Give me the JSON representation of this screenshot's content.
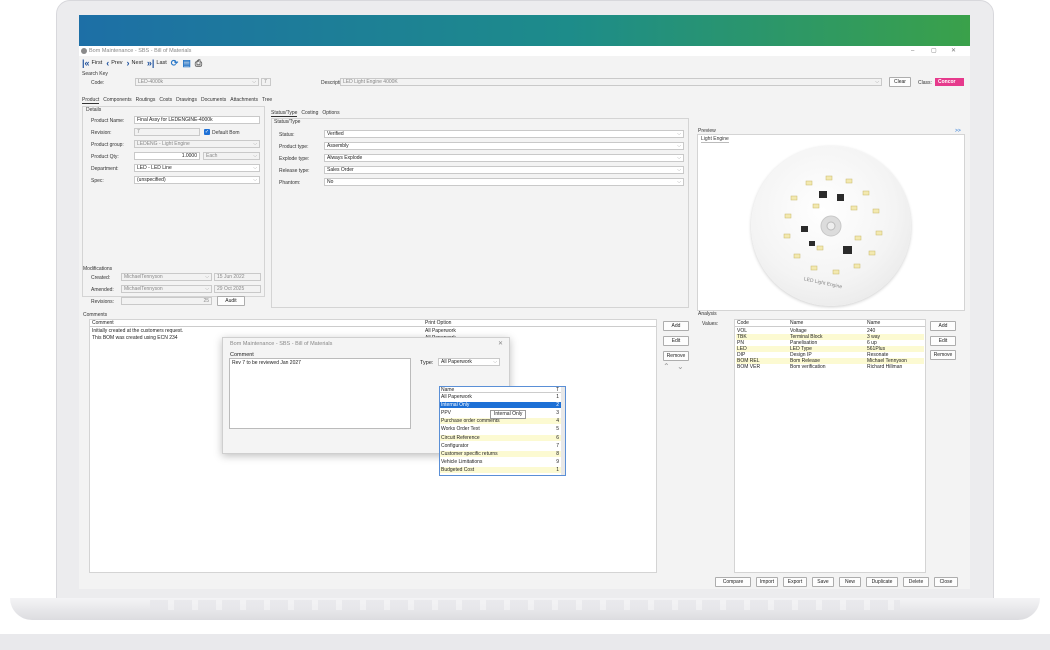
{
  "window": {
    "title": "Bom Maintenance - SBS - Bill of Materials"
  },
  "toolbar": {
    "first": "First",
    "prev": "Prev",
    "next": "Next",
    "last": "Last"
  },
  "search_key": {
    "title": "Search Key",
    "code_label": "Code:",
    "code_value": "LED-4000k",
    "revision_value": "7",
    "description_label": "Description:",
    "description_value": "LED Light Engine 4000K",
    "clear_label": "Clear",
    "class_label": "Class:",
    "class_value": "Concor"
  },
  "main_tabs": [
    "Product",
    "Components",
    "Routings",
    "Costs",
    "Drawings",
    "Documents",
    "Attachments",
    "Tree"
  ],
  "details": {
    "title": "Details",
    "product_name_label": "Product Name:",
    "product_name_value": "Final Assy for LEDENGINE-4000k",
    "revision_label": "Revision:",
    "revision_value": "7",
    "default_bom_label": "Default Bom",
    "product_group_label": "Product group:",
    "product_group_value": "LEDENG - Light Engine",
    "product_qty_label": "Product Qty:",
    "product_qty_value": "1.0000",
    "product_qty_unit": "Each",
    "department_label": "Department:",
    "department_value": "LED - LED Line",
    "spec_label": "Spec:",
    "spec_value": "(unspecified)"
  },
  "status_tabs": [
    "Status/Type",
    "Costing",
    "Options"
  ],
  "status_type": {
    "title": "Status/Type",
    "rows": [
      {
        "label": "Status:",
        "value": "Verified"
      },
      {
        "label": "Product type:",
        "value": "Assembly"
      },
      {
        "label": "Explode type:",
        "value": "Always Explode"
      },
      {
        "label": "Release type:",
        "value": "Sales Order"
      },
      {
        "label": "Phantom:",
        "value": "No"
      }
    ]
  },
  "preview": {
    "title": "Preview",
    "expand": ">>",
    "tab": "Light Engine"
  },
  "modifications": {
    "title": "Modifications",
    "created_label": "Created:",
    "created_user": "MichaelTennyson",
    "created_date": "15 Jun 2022",
    "amended_label": "Amended:",
    "amended_user": "MichaelTennyson",
    "amended_date": "29 Oct 2025",
    "revisions_label": "Revisions:",
    "revisions_value": "25",
    "audit_label": "Audit"
  },
  "comments": {
    "title": "Comments",
    "columns": [
      "Comment",
      "Print Option"
    ],
    "rows": [
      {
        "comment": "Initially created at the customers request.",
        "print": "All Paperwork"
      },
      {
        "comment": "This BOM was created using ECN 234",
        "print": "All Paperwork"
      }
    ],
    "add": "Add",
    "edit": "Edit",
    "remove": "Remove"
  },
  "analysis": {
    "title": "Analysis",
    "values_label": "Values:",
    "columns": [
      "Code",
      "Name",
      "Name"
    ],
    "rows": [
      {
        "code": "VOL",
        "name": "Voltage",
        "value": "240"
      },
      {
        "code": "TBK",
        "name": "Terminal Block",
        "value": "3 way"
      },
      {
        "code": "PN",
        "name": "Panelisation",
        "value": "6 up"
      },
      {
        "code": "LED",
        "name": "LED Type",
        "value": "561Plus"
      },
      {
        "code": "DIP",
        "name": "Design IP",
        "value": "Resonate"
      },
      {
        "code": "BOM REL",
        "name": "Bom Release",
        "value": "Michael Tennyson"
      },
      {
        "code": "BOM VER",
        "name": "Bom verification",
        "value": "Richard Hillman"
      }
    ],
    "add": "Add",
    "edit": "Edit",
    "remove": "Remove"
  },
  "dialog": {
    "title": "Bom Maintenance - SBS - Bill of Materials",
    "comment_label": "Comment",
    "comment_value": "Rev 7 to be reviewed Jan 2027",
    "type_label": "Type:",
    "type_value": "All Paperwork",
    "list_header_name": "Name",
    "list_header_num": "T",
    "options": [
      {
        "name": "All Paperwork",
        "num": "1"
      },
      {
        "name": "Internal Only",
        "num": "2"
      },
      {
        "name": "PPV",
        "num": "3"
      },
      {
        "name": "Purchase order comments",
        "num": "4"
      },
      {
        "name": "Works Order Text",
        "num": "5"
      },
      {
        "name": "Circuit Reference",
        "num": "6"
      },
      {
        "name": "Configurator",
        "num": "7"
      },
      {
        "name": "Customer specific returns",
        "num": "8"
      },
      {
        "name": "Vehicle Limitations",
        "num": "9"
      },
      {
        "name": "Budgeted Cost",
        "num": "1"
      }
    ],
    "tooltip": "Internal Only"
  },
  "footer": [
    "Compare",
    "Import",
    "Export",
    "Save",
    "New",
    "Duplicate",
    "Delete",
    "Close"
  ]
}
